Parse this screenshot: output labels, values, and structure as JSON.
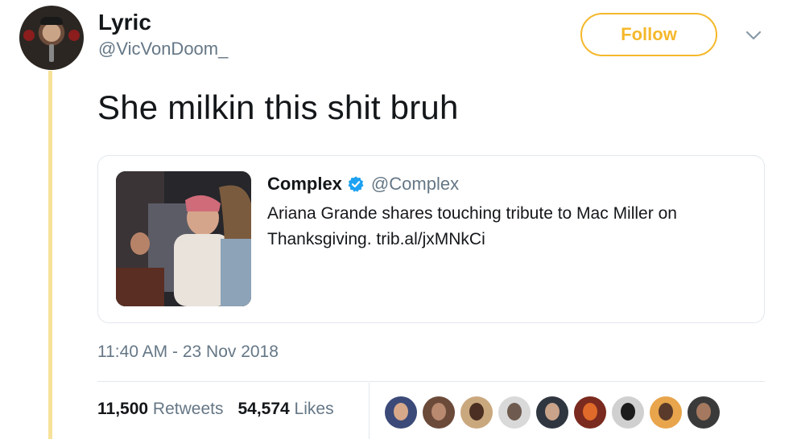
{
  "author": {
    "display_name": "Lyric",
    "handle": "@VicVonDoom_"
  },
  "follow_label": "Follow",
  "tweet": {
    "text": "She milkin this shit bruh"
  },
  "quote": {
    "name": "Complex",
    "verified": true,
    "handle": "@Complex",
    "text": "Ariana Grande shares touching tribute to Mac Miller on Thanksgiving. trib.al/jxMNkCi"
  },
  "timestamp": "11:40 AM - 23 Nov 2018",
  "stats": {
    "retweets_count": "11,500",
    "retweets_label": "Retweets",
    "likes_count": "54,574",
    "likes_label": "Likes"
  },
  "colors": {
    "accent": "#f5b82b",
    "thread_line": "#f6e29a",
    "secondary_text": "#657786",
    "verified": "#1da1f2"
  },
  "icons": {
    "caret": "chevron-down-icon",
    "verified": "verified-badge-icon"
  },
  "liker_avatars": [
    {
      "bg": "#3b4a78",
      "fg": "#d7a98a"
    },
    {
      "bg": "#6b4a3a",
      "fg": "#b98a6f"
    },
    {
      "bg": "#caa87e",
      "fg": "#4a2f22"
    },
    {
      "bg": "#d9d9d9",
      "fg": "#6e5a4e"
    },
    {
      "bg": "#2f3640",
      "fg": "#c9a38a"
    },
    {
      "bg": "#7a2a1e",
      "fg": "#e06a2a"
    },
    {
      "bg": "#d0d0d0",
      "fg": "#1c1c1c"
    },
    {
      "bg": "#e8a54c",
      "fg": "#5a3a2a"
    },
    {
      "bg": "#3a3a3a",
      "fg": "#a5795f"
    }
  ]
}
